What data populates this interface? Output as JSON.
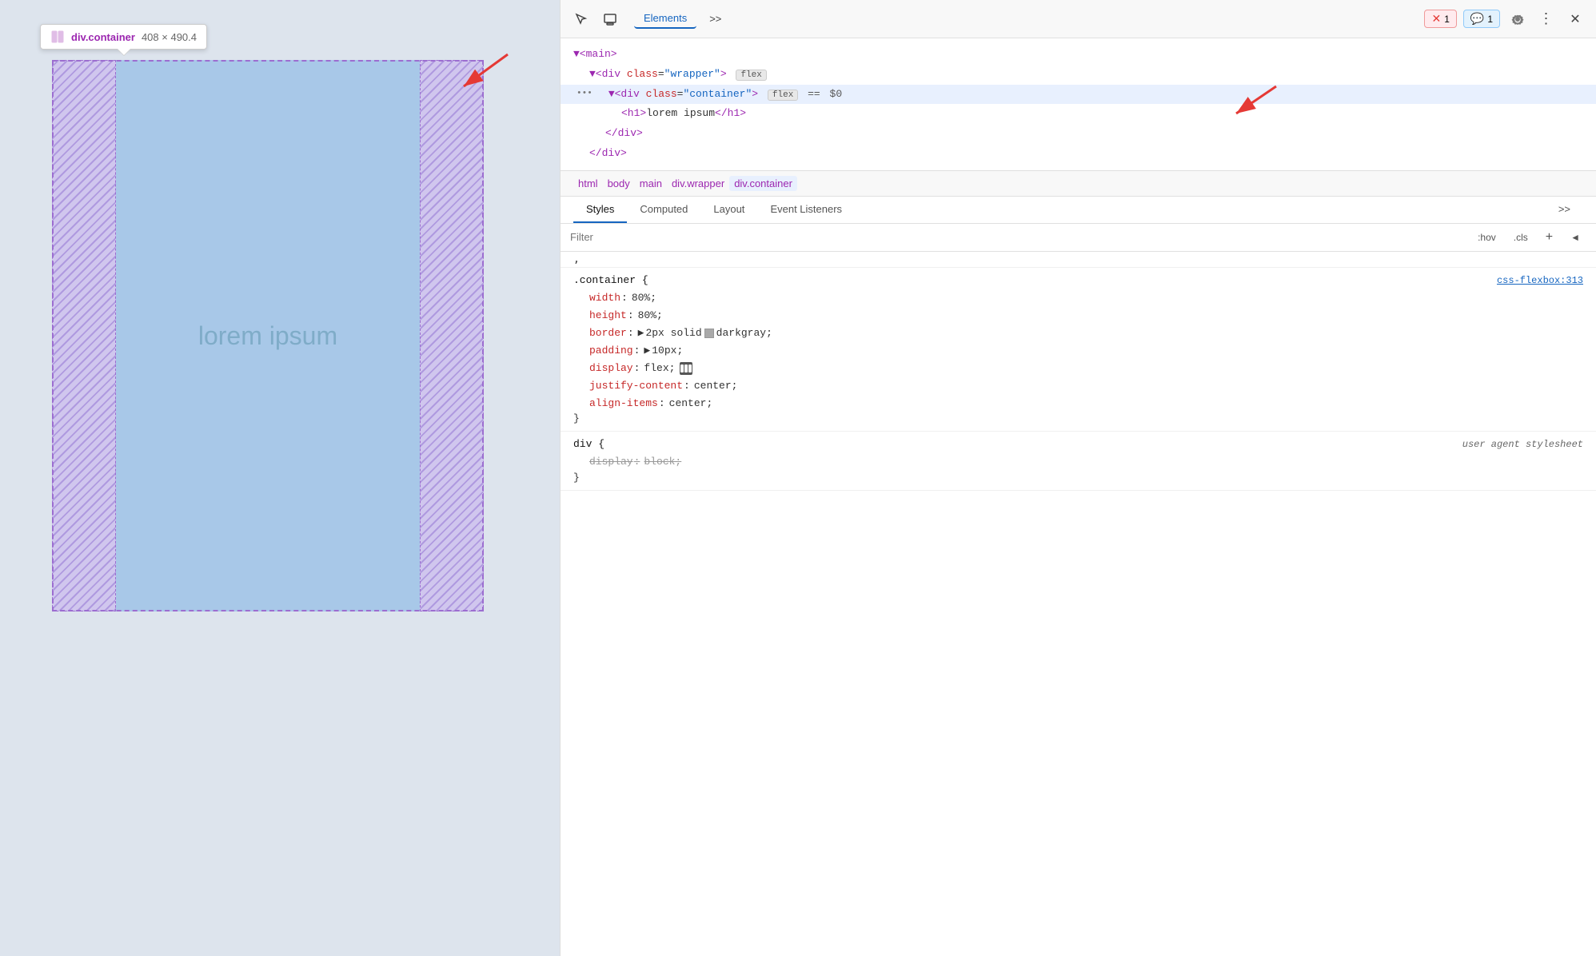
{
  "tooltip": {
    "tag": "div.container",
    "size": "408 × 490.4"
  },
  "preview": {
    "lorem_text": "lorem ipsum"
  },
  "devtools": {
    "tabs": [
      "Elements",
      ">>"
    ],
    "active_tab": "Elements",
    "error_badge": "1",
    "console_badge": "1",
    "dom_lines": [
      {
        "indent": 0,
        "content": "▼<main>"
      },
      {
        "indent": 1,
        "content": "▼<div class=\"wrapper\">",
        "badge": "flex"
      },
      {
        "indent": 2,
        "content": "▼<div class=\"container\">",
        "badge": "flex",
        "selected": true,
        "extra": "== $0"
      },
      {
        "indent": 3,
        "content": "<h1>lorem ipsum</h1>"
      },
      {
        "indent": 2,
        "content": "</div>"
      },
      {
        "indent": 1,
        "content": "</div>"
      }
    ],
    "breadcrumbs": [
      "html",
      "body",
      "main",
      "div.wrapper",
      "div.container"
    ],
    "style_tabs": [
      "Styles",
      "Computed",
      "Layout",
      "Event Listeners",
      ">>"
    ],
    "active_style_tab": "Styles",
    "filter_placeholder": "Filter",
    "filter_buttons": [
      ":hov",
      ".cls",
      "+",
      "◄"
    ],
    "css_rules": [
      {
        "selector": ".container {",
        "source": "css-flexbox:313",
        "properties": [
          {
            "name": "width",
            "value": "80%",
            "strikethrough": false
          },
          {
            "name": "height",
            "value": "80%",
            "strikethrough": false
          },
          {
            "name": "border",
            "value": "2px solid  darkgray;",
            "has_swatch": true,
            "swatch_color": "#a9a9a9",
            "strikethrough": false
          },
          {
            "name": "padding",
            "value": "10px",
            "has_arrow": true,
            "strikethrough": false
          },
          {
            "name": "display",
            "value": "flex",
            "has_icon": true,
            "strikethrough": false
          },
          {
            "name": "justify-content",
            "value": "center",
            "strikethrough": false
          },
          {
            "name": "align-items",
            "value": "center",
            "strikethrough": false
          }
        ],
        "close": "}"
      },
      {
        "selector": "div {",
        "source": "user agent stylesheet",
        "source_italic": true,
        "properties": [
          {
            "name": "display",
            "value": "block",
            "strikethrough": true
          }
        ],
        "close": "}"
      }
    ]
  }
}
